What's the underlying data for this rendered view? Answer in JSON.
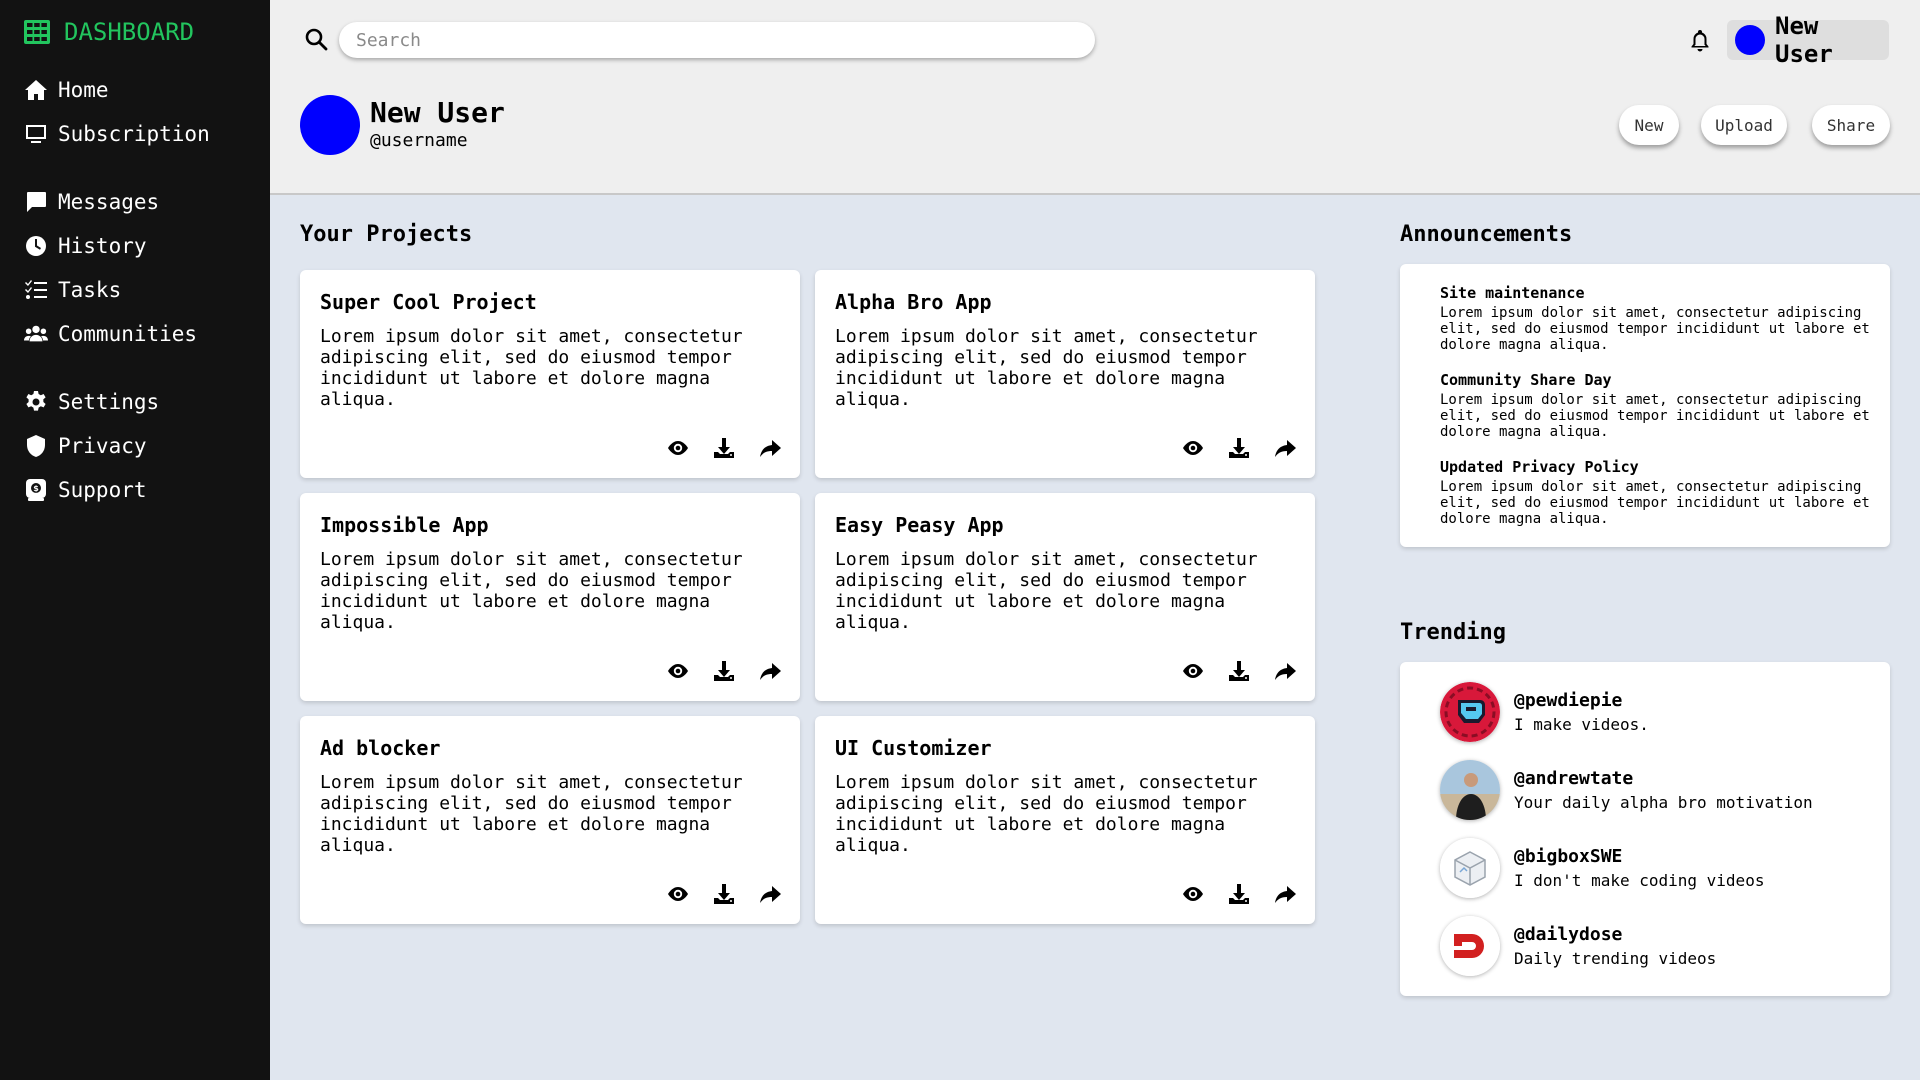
{
  "sidebar": {
    "brand": "DASHBOARD",
    "items": [
      {
        "label": "Home",
        "icon": "home-icon"
      },
      {
        "label": "Subscription",
        "icon": "monitor-icon"
      },
      {
        "label": "Messages",
        "icon": "message-icon"
      },
      {
        "label": "History",
        "icon": "clock-icon"
      },
      {
        "label": "Tasks",
        "icon": "tasks-icon"
      },
      {
        "label": "Communities",
        "icon": "users-icon"
      },
      {
        "label": "Settings",
        "icon": "gear-icon"
      },
      {
        "label": "Privacy",
        "icon": "shield-icon"
      },
      {
        "label": "Support",
        "icon": "support-icon"
      }
    ]
  },
  "search": {
    "placeholder": "Search"
  },
  "header": {
    "user_badge": "New User"
  },
  "profile": {
    "name": "New User",
    "username": "@username",
    "buttons": {
      "new": "New",
      "upload": "Upload",
      "share": "Share"
    }
  },
  "projects": {
    "title": "Your Projects",
    "items": [
      {
        "title": "Super Cool Project",
        "desc": "Lorem ipsum dolor sit amet, consectetur adipiscing elit, sed do eiusmod tempor incididunt ut labore et dolore magna aliqua."
      },
      {
        "title": "Alpha Bro App",
        "desc": "Lorem ipsum dolor sit amet, consectetur adipiscing elit, sed do eiusmod tempor incididunt ut labore et dolore magna aliqua."
      },
      {
        "title": "Impossible App",
        "desc": "Lorem ipsum dolor sit amet, consectetur adipiscing elit, sed do eiusmod tempor incididunt ut labore et dolore magna aliqua."
      },
      {
        "title": "Easy Peasy App",
        "desc": "Lorem ipsum dolor sit amet, consectetur adipiscing elit, sed do eiusmod tempor incididunt ut labore et dolore magna aliqua."
      },
      {
        "title": "Ad blocker",
        "desc": "Lorem ipsum dolor sit amet, consectetur adipiscing elit, sed do eiusmod tempor incididunt ut labore et dolore magna aliqua."
      },
      {
        "title": "UI Customizer",
        "desc": "Lorem ipsum dolor sit amet, consectetur adipiscing elit, sed do eiusmod tempor incididunt ut labore et dolore magna aliqua."
      }
    ]
  },
  "announcements": {
    "title": "Announcements",
    "items": [
      {
        "title": "Site maintenance",
        "body": "Lorem ipsum dolor sit amet, consectetur adipiscing elit, sed do eiusmod tempor incididunt ut labore et dolore magna aliqua."
      },
      {
        "title": "Community Share Day",
        "body": "Lorem ipsum dolor sit amet, consectetur adipiscing elit, sed do eiusmod tempor incididunt ut labore et dolore magna aliqua."
      },
      {
        "title": "Updated Privacy Policy",
        "body": "Lorem ipsum dolor sit amet, consectetur adipiscing elit, sed do eiusmod tempor incididunt ut labore et dolore magna aliqua."
      }
    ]
  },
  "trending": {
    "title": "Trending",
    "items": [
      {
        "handle": "@pewdiepie",
        "tagline": "I make videos."
      },
      {
        "handle": "@andrewtate",
        "tagline": "Your daily alpha bro motivation"
      },
      {
        "handle": "@bigboxSWE",
        "tagline": "I don't make coding videos"
      },
      {
        "handle": "@dailydose",
        "tagline": "Daily trending videos"
      }
    ]
  },
  "colors": {
    "brand": "#22c55e",
    "sidebar_bg": "#121212",
    "avatar": "#0000ff",
    "content_bg": "#e0e6ef"
  }
}
